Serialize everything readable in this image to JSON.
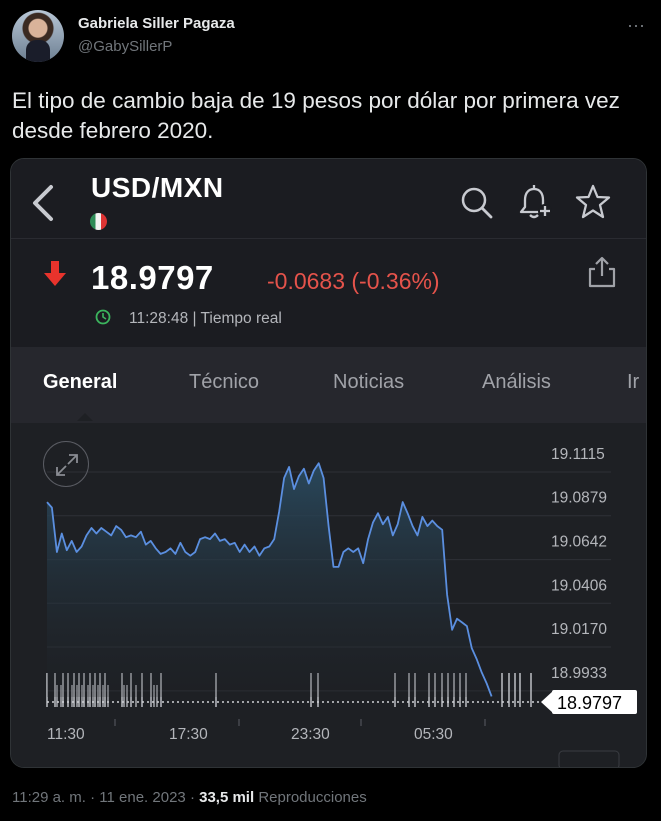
{
  "tweet": {
    "display_name": "Gabriela Siller Pagaza",
    "handle": "@GabySillerP",
    "more_icon": "⋯",
    "text": "El tipo de cambio baja de 19 pesos por dólar por primera vez desde febrero 2020.",
    "footer": {
      "time": "11:29 a. m.",
      "separator": "·",
      "date": "11 ene. 2023",
      "views": "33,5 mil",
      "views_label": "Reproducciones"
    }
  },
  "app": {
    "pair": "USD/MXN",
    "icons": [
      "back-icon",
      "mexico-flag-icon",
      "search-icon",
      "bell-plus-icon",
      "star-icon",
      "share-icon",
      "clock-icon",
      "expand-icon",
      "down-arrow-icon"
    ],
    "price": "18.9797",
    "change": "-0.0683 (-0.36%)",
    "time": "11:28:48 | Tiempo real",
    "tabs": [
      "General",
      "Técnico",
      "Noticias",
      "Análisis",
      "Ir"
    ],
    "active_tab": "General",
    "colors": {
      "down": "#e5534b",
      "line": "#5b8fe0",
      "background": "#1b1c21",
      "arrow": "#e8332c"
    }
  },
  "chart_data": {
    "type": "area",
    "x_tick_labels": [
      "11:30",
      "17:30",
      "23:30",
      "05:30"
    ],
    "y_tick_labels": [
      "19.1115",
      "19.0879",
      "19.0642",
      "19.0406",
      "19.0170",
      "18.9933"
    ],
    "ylim": [
      18.9797,
      19.1115
    ],
    "current_label": "18.9797",
    "grid": true,
    "x": [
      0,
      1,
      2,
      3,
      4,
      5,
      6,
      7,
      8,
      9,
      10,
      11,
      12,
      13,
      14,
      15,
      16,
      17,
      18,
      19,
      20,
      21,
      22,
      23,
      24,
      25,
      26,
      27,
      28,
      29,
      30,
      31,
      32,
      33,
      34,
      35,
      36,
      37,
      38,
      39,
      40,
      41,
      42,
      43,
      44,
      45,
      46,
      47,
      48,
      49,
      50,
      51,
      52,
      53,
      54,
      55,
      56,
      57,
      58,
      59,
      60,
      61,
      62,
      63,
      64,
      65,
      66,
      67,
      68,
      69,
      70,
      71,
      72,
      73,
      74,
      75,
      76,
      77,
      78,
      79,
      80,
      81,
      82,
      83,
      84,
      85,
      86,
      87,
      88,
      89,
      90,
      91,
      92,
      93,
      94,
      95,
      96,
      97,
      98,
      99,
      100
    ],
    "values": [
      19.085,
      19.082,
      19.058,
      19.068,
      19.059,
      19.064,
      19.058,
      19.061,
      19.067,
      19.071,
      19.068,
      19.071,
      19.069,
      19.067,
      19.072,
      19.07,
      19.066,
      19.067,
      19.066,
      19.069,
      19.062,
      19.064,
      19.06,
      19.057,
      19.058,
      19.06,
      19.057,
      19.063,
      19.058,
      19.056,
      19.058,
      19.065,
      19.066,
      19.065,
      19.068,
      19.064,
      19.065,
      19.062,
      19.063,
      19.058,
      19.062,
      19.058,
      19.061,
      19.056,
      19.06,
      19.061,
      19.065,
      19.08,
      19.098,
      19.104,
      19.092,
      19.099,
      19.103,
      19.095,
      19.102,
      19.106,
      19.098,
      19.072,
      19.05,
      19.05,
      19.058,
      19.06,
      19.058,
      19.06,
      19.052,
      19.065,
      19.074,
      19.079,
      19.073,
      19.077,
      19.067,
      19.073,
      19.085,
      19.079,
      19.072,
      19.067,
      19.077,
      19.072,
      19.075,
      19.072,
      19.07,
      19.035,
      19.016,
      19.022,
      19.02,
      19.018,
      19.006,
      19.0,
      18.993,
      18.987,
      18.98
    ]
  }
}
